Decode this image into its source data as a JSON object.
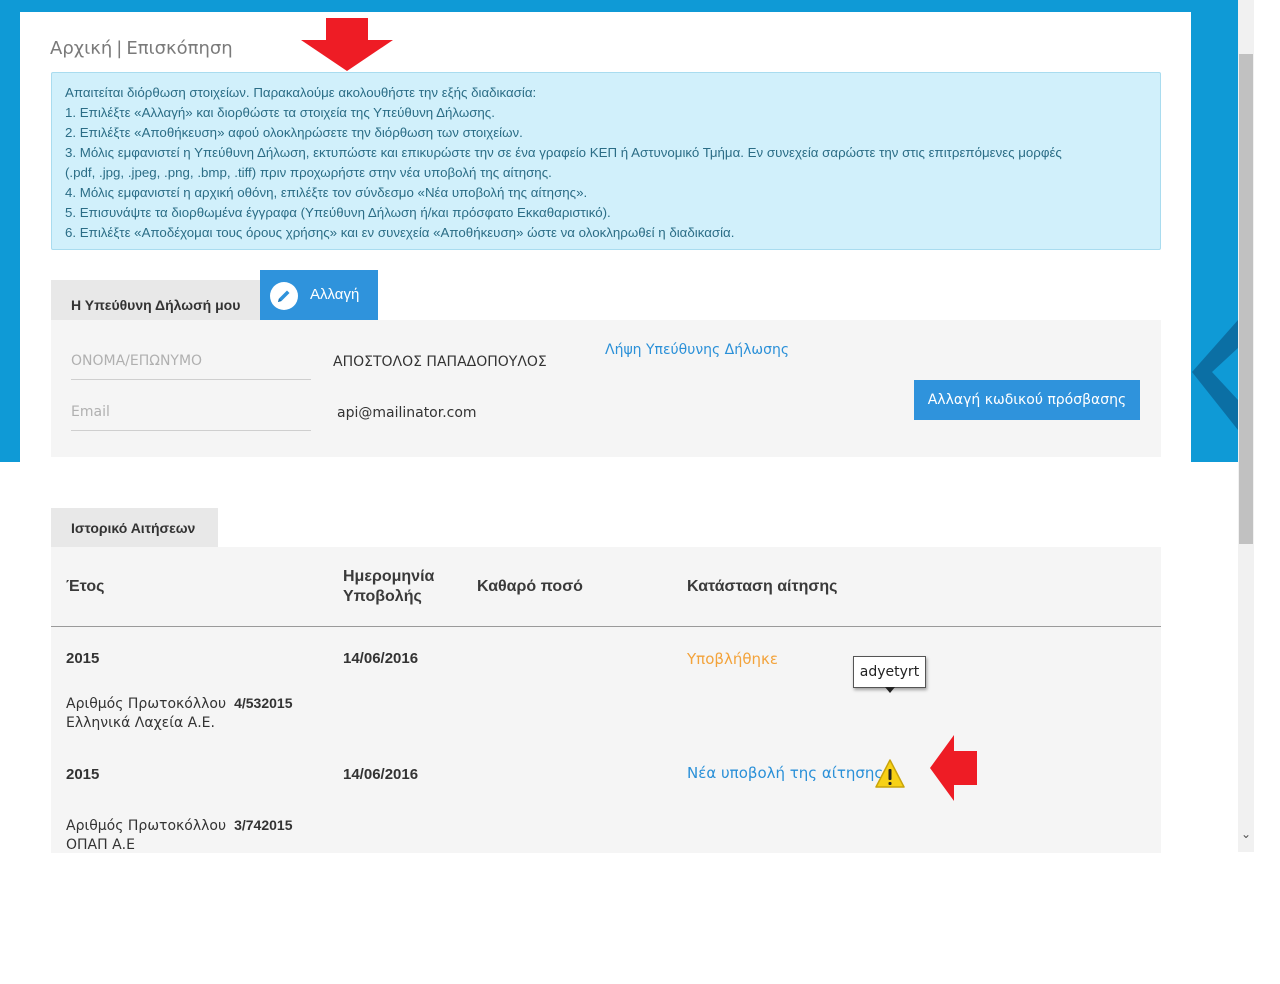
{
  "breadcrumb": {
    "home": "Αρχική",
    "separator": "|",
    "current": "Επισκόπηση"
  },
  "alert": {
    "lines": [
      "Απαιτείται διόρθωση στοιχείων. Παρακαλούμε ακολουθήστε την εξής διαδικασία:",
      "1. Επιλέξτε «Αλλαγή» και διορθώστε τα στοιχεία της Υπεύθυνη Δήλωσης.",
      "2. Επιλέξτε «Αποθήκευση» αφού ολοκληρώσετε την διόρθωση των στοιχείων.",
      "3. Μόλις εμφανιστεί η Υπεύθυνη Δήλωση, εκτυπώστε και επικυρώστε την σε ένα γραφείο ΚΕΠ ή Αστυνομικό Τμήμα. Εν συνεχεία σαρώστε την στις επιτρεπόμενες μορφές",
      "(.pdf, .jpg, .jpeg, .png, .bmp, .tiff) πριν προχωρήστε στην νέα υποβολή της αίτησης.",
      "4. Μόλις εμφανιστεί η αρχική οθόνη, επιλέξτε τον σύνδεσμο «Νέα υποβολή της αίτησης».",
      "5. Επισυνάψτε τα διορθωμένα έγγραφα (Υπεύθυνη Δήλωση ή/και πρόσφατο Εκκαθαριστικό).",
      "6. Επιλέξτε «Αποδέχομαι τους όρους χρήσης» και εν συνεχεία «Αποθήκευση» ώστε να ολοκληρωθεί η διαδικασία."
    ]
  },
  "declaration": {
    "tab_label": "Η Υπεύθυνη Δήλωσή μου",
    "change_label": "Αλλαγή",
    "name_label": "ΟΝΟΜΑ/ΕΠΩΝΥΜΟ",
    "name_value": "ΑΠΟΣΤΟΛΟΣ ΠΑΠΑΔΟΠΟΥΛΟΣ",
    "email_label": "Email",
    "email_value": "api@mailinator.com",
    "get_declaration_link": "Λήψη Υπεύθυνης Δήλωσης",
    "change_password_button": "Αλλαγή κωδικού πρόσβασης"
  },
  "history": {
    "tab_label": "Ιστορικό Αιτήσεων",
    "columns": {
      "year": "Έτος",
      "date_line1": "Ημερομηνία",
      "date_line2": "Υποβολής",
      "amount": "Καθαρό ποσό",
      "status": "Κατάσταση αίτησης"
    },
    "protocol_label": "Αριθμός Πρωτοκόλλου",
    "rows": [
      {
        "year": "2015",
        "date": "14/06/2016",
        "status": "Υποβλήθηκε",
        "protocol": "4/532015",
        "company": "Ελληνικά Λαχεία Α.Ε."
      },
      {
        "year": "2015",
        "date": "14/06/2016",
        "status": "Νέα υποβολή της αίτησης",
        "protocol": "3/742015",
        "company": "ΟΠΑΠ Α.Ε"
      }
    ]
  },
  "tooltip": {
    "text": "adyetyrt"
  },
  "icons": {
    "edit": "pencil-icon",
    "warning": "warning-icon",
    "scroll_down": "chevron-down-icon",
    "annotation_down": "red-arrow-down",
    "annotation_left": "red-arrow-left"
  },
  "colors": {
    "header_blue": "#0f9ad6",
    "primary_button": "#2f93dc",
    "link": "#2a90d8",
    "status_submitted": "#f3a33b",
    "alert_bg": "#d1f0fb",
    "annotation_red": "#ee1c25"
  }
}
